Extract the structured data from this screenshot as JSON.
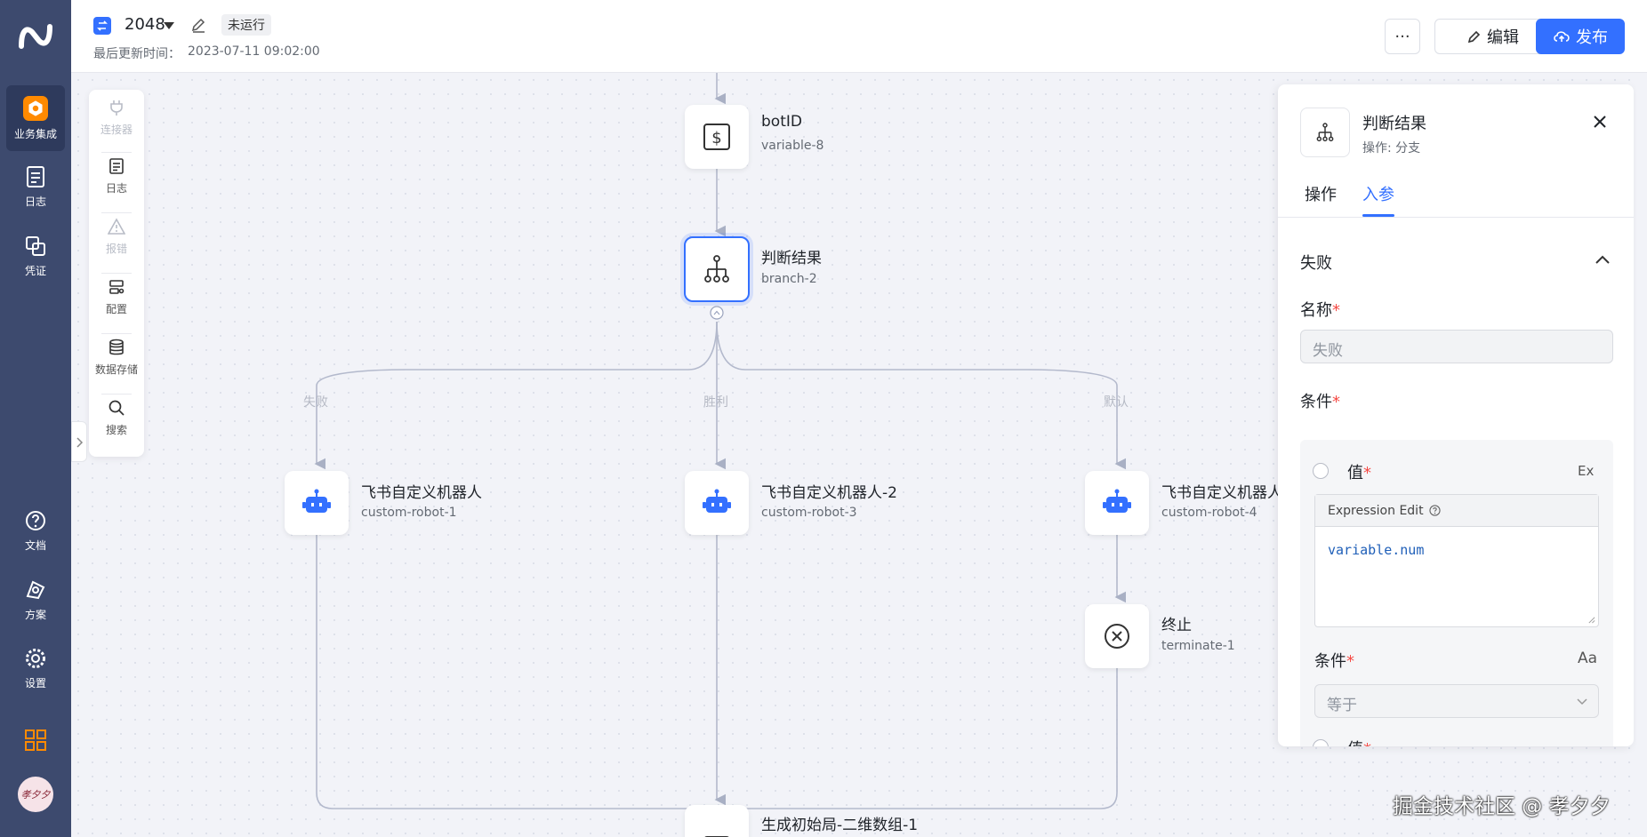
{
  "sidebar": {
    "items": [
      {
        "label": "业务集成",
        "icon": "integration-icon"
      },
      {
        "label": "日志",
        "icon": "log-icon"
      },
      {
        "label": "凭证",
        "icon": "credential-icon"
      }
    ],
    "bottom": [
      {
        "label": "文档",
        "icon": "help-icon"
      },
      {
        "label": "方案",
        "icon": "solution-icon"
      },
      {
        "label": "设置",
        "icon": "gear-icon"
      }
    ],
    "avatar_text": "孝夕夕"
  },
  "header": {
    "flow_name": "2048",
    "status": "未运行",
    "updated_label": "最后更新时间：",
    "updated_time": "2023-07-11 09:02:00",
    "more": "···",
    "edit_label": "编辑",
    "publish_label": "发布"
  },
  "toolbox": [
    {
      "label": "连接器",
      "disabled": true
    },
    {
      "label": "日志",
      "disabled": false
    },
    {
      "label": "报错",
      "disabled": true
    },
    {
      "label": "配置",
      "disabled": false
    },
    {
      "label": "数据存储",
      "disabled": false
    },
    {
      "label": "搜索",
      "disabled": false
    }
  ],
  "nodes": {
    "botid": {
      "title": "botID",
      "sub": "variable-8"
    },
    "branch": {
      "title": "判断结果",
      "sub": "branch-2"
    },
    "robot1": {
      "title": "飞书自定义机器人",
      "sub": "custom-robot-1"
    },
    "robot3": {
      "title": "飞书自定义机器人-2",
      "sub": "custom-robot-3"
    },
    "robot4": {
      "title": "飞书自定义机器人",
      "sub": "custom-robot-4"
    },
    "terminate": {
      "title": "终止",
      "sub": "terminate-1"
    },
    "gen": {
      "title": "生成初始局-二维数组-1"
    }
  },
  "edges": {
    "fail": "失败",
    "win": "胜利",
    "default": "默认"
  },
  "panel": {
    "title": "判断结果",
    "subtitle": "操作: 分支",
    "tabs": [
      "操作",
      "入参"
    ],
    "active_tab": 1,
    "section": "失败",
    "name_label": "名称",
    "name_value": "失败",
    "condition_label": "条件",
    "value_label": "值",
    "ex_label": "Ex",
    "expr_header": "Expression Edit",
    "expr_code": "variable.num",
    "cond2_label": "条件",
    "aa_label": "Aa",
    "select_value": "等于",
    "value2_label": "值"
  },
  "watermark": "掘金技术社区 @ 孝夕夕",
  "colors": {
    "primary": "#3370ff",
    "sidebar": "#3d4a6e",
    "brand_orange": "#ff8a00",
    "required": "#f54a45"
  }
}
